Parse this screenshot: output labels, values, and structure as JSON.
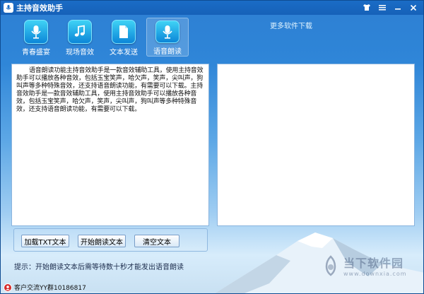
{
  "window": {
    "title": "主持音效助手"
  },
  "toolbar": {
    "items": [
      {
        "label": "青春盛宴",
        "icon": "microphone-icon"
      },
      {
        "label": "现场音效",
        "icon": "music-note-icon"
      },
      {
        "label": "文本发送",
        "icon": "document-icon"
      },
      {
        "label": "语音朗读",
        "icon": "microphone-icon"
      }
    ],
    "active_index": 3
  },
  "header": {
    "more_link": "更多软件下载"
  },
  "editor": {
    "text": "语音朗读功能主持音效助手是一款音效辅助工具，使用主持音效助手可以播放各种音效，包括玉宝笑声，哈欠声，笑声，尖叫声，狗叫声等多种特殊音效，还支持语音朗读功能，有需要可以下载。主持音效助手是一款音效辅助工具，使用主持音效助手可以播放各种音效，包括玉宝笑声，哈欠声，笑声，尖叫声，狗叫声等多种特殊音效，还支持语音朗读功能，有需要可以下载。"
  },
  "buttons": {
    "load_txt": "加载TXT文本",
    "start_read": "开始朗读文本",
    "clear_text": "清空文本"
  },
  "hint": "提示：开始朗读文本后需等待数十秒才能发出语音朗读",
  "status": {
    "text": "客户交流YY群10186817"
  },
  "watermark": {
    "cn": "当下软件园",
    "en": "www.downxia.com"
  },
  "colors": {
    "title_bar": "#1661b8",
    "icon_bg": "#0c86d8",
    "status_badge": "#d52a2a"
  }
}
